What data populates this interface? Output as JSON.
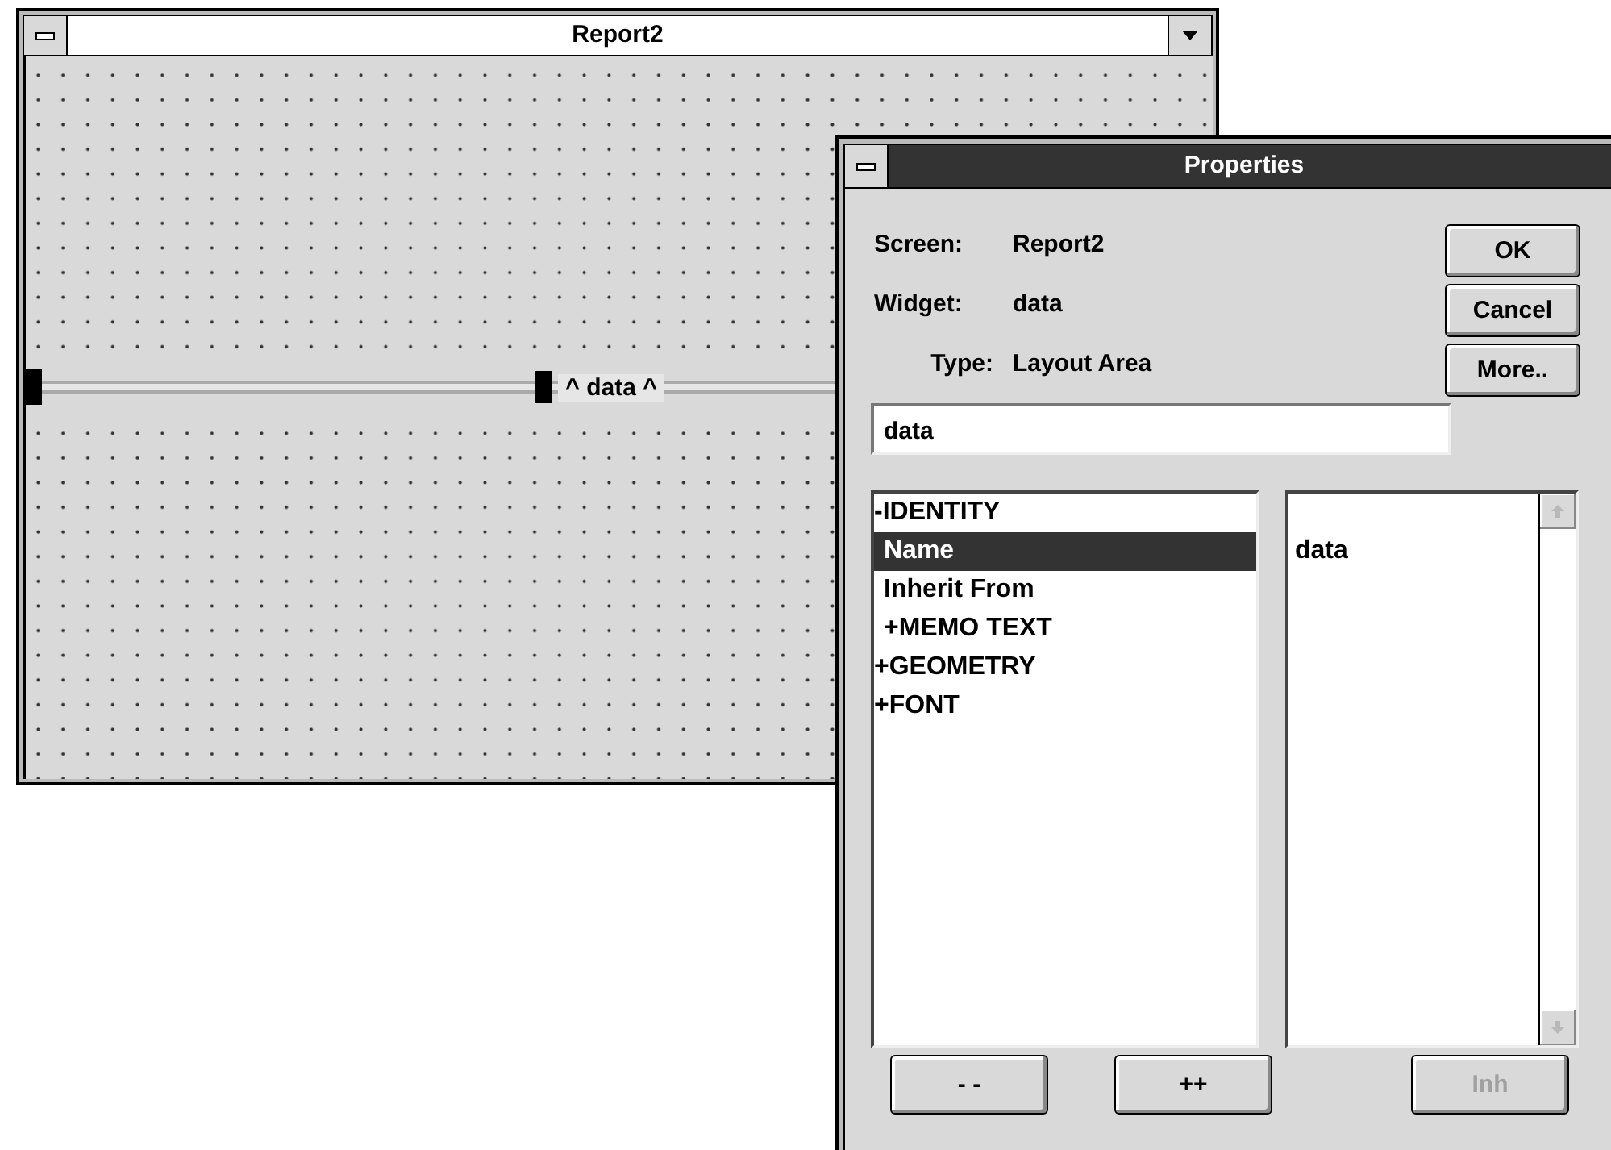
{
  "report_window": {
    "title": "Report2",
    "band": {
      "label": "^ data ^"
    }
  },
  "properties_dialog": {
    "title": "Properties",
    "info": [
      {
        "label": "Screen:",
        "value": "Report2"
      },
      {
        "label": "Widget:",
        "value": "data"
      },
      {
        "label": "Type:",
        "value": "Layout Area"
      }
    ],
    "buttons": [
      {
        "label": "OK",
        "disabled": false
      },
      {
        "label": "Cancel",
        "disabled": false
      },
      {
        "label": "More..",
        "disabled": false
      }
    ],
    "name_field": {
      "value": "data"
    },
    "property_tree": [
      {
        "label": "-IDENTITY",
        "selected": false,
        "children": [
          {
            "label": "Name",
            "selected": true
          },
          {
            "label": "Inherit From",
            "selected": false
          },
          {
            "label": "+MEMO TEXT",
            "selected": false
          }
        ]
      },
      {
        "label": "+GEOMETRY",
        "selected": false
      },
      {
        "label": "+FONT",
        "selected": false
      }
    ],
    "value_list": [
      "data"
    ],
    "bottom_buttons": [
      {
        "label": "- -",
        "disabled": false
      },
      {
        "label": "++",
        "disabled": false
      },
      {
        "label": "Inh",
        "disabled": true
      }
    ]
  }
}
